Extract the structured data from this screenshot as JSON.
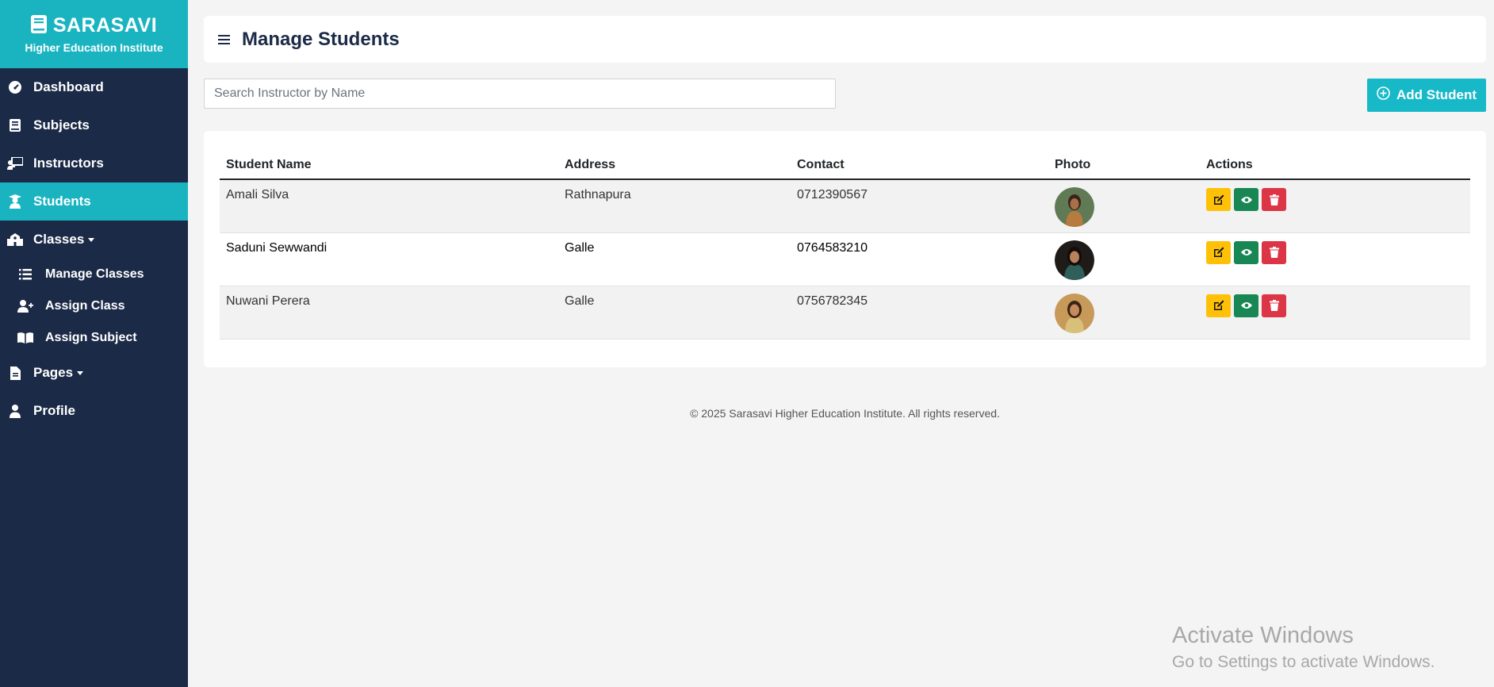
{
  "brand": {
    "title": "SARASAVI",
    "subtitle": "Higher Education Institute"
  },
  "sidebar": {
    "items": [
      {
        "label": "Dashboard",
        "icon": "gauge-icon"
      },
      {
        "label": "Subjects",
        "icon": "book-icon"
      },
      {
        "label": "Instructors",
        "icon": "chalkboard-teacher-icon"
      },
      {
        "label": "Students",
        "icon": "user-graduate-icon",
        "active": true
      },
      {
        "label": "Classes",
        "icon": "school-icon",
        "dropdown": true
      },
      {
        "label": "Pages",
        "icon": "file-icon",
        "dropdown": true
      },
      {
        "label": "Profile",
        "icon": "user-icon"
      }
    ],
    "classes_submenu": [
      {
        "label": "Manage Classes",
        "icon": "list-icon"
      },
      {
        "label": "Assign Class",
        "icon": "user-plus-icon"
      },
      {
        "label": "Assign Subject",
        "icon": "book-open-icon"
      }
    ]
  },
  "header": {
    "title": "Manage Students"
  },
  "search": {
    "placeholder": "Search Instructor by Name"
  },
  "add_button": {
    "label": "Add Student"
  },
  "table": {
    "headers": [
      "Student Name",
      "Address",
      "Contact",
      "Photo",
      "Actions"
    ],
    "rows": [
      {
        "name": "Amali Silva",
        "address": "Rathnapura",
        "contact": "0712390567"
      },
      {
        "name": "Saduni Sewwandi",
        "address": "Galle",
        "contact": "0764583210"
      },
      {
        "name": "Nuwani Perera",
        "address": "Galle",
        "contact": "0756782345"
      }
    ]
  },
  "footer": {
    "text": "© 2025 Sarasavi Higher Education Institute. All rights reserved."
  },
  "watermark": {
    "line1": "Activate Windows",
    "line2": "Go to Settings to activate Windows."
  },
  "colors": {
    "sidebar": "#1b2a47",
    "accent": "#1ab4c1",
    "edit": "#ffc107",
    "view": "#198754",
    "delete": "#dc3545"
  }
}
